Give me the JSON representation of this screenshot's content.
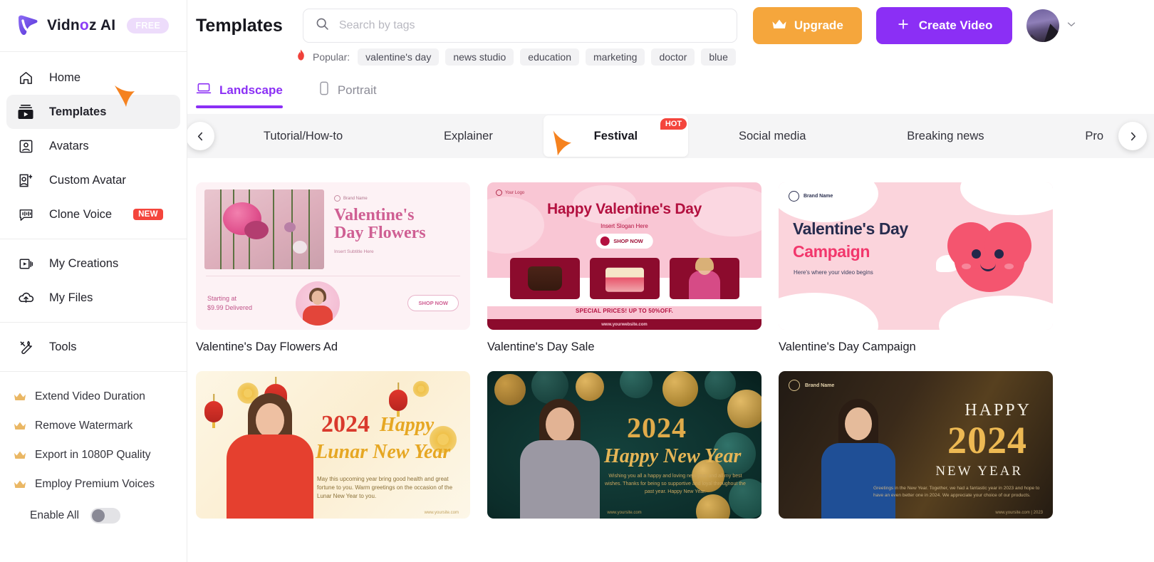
{
  "brand": {
    "name_pre": "Vidn",
    "name_o": "o",
    "name_post": "z AI",
    "plan_badge": "FREE"
  },
  "sidebar": {
    "nav_primary": [
      {
        "label": "Home",
        "icon": "home-icon",
        "active": false
      },
      {
        "label": "Templates",
        "icon": "templates-icon",
        "active": true
      },
      {
        "label": "Avatars",
        "icon": "avatar-icon",
        "active": false
      },
      {
        "label": "Custom Avatar",
        "icon": "custom-avatar-icon",
        "active": false
      },
      {
        "label": "Clone Voice",
        "icon": "voice-icon",
        "active": false,
        "badge": "NEW"
      }
    ],
    "nav_secondary": [
      {
        "label": "My Creations",
        "icon": "creations-icon"
      },
      {
        "label": "My Files",
        "icon": "files-icon"
      }
    ],
    "nav_tools": [
      {
        "label": "Tools",
        "icon": "tools-icon"
      }
    ],
    "perks": [
      {
        "label": "Extend Video Duration",
        "icon": "crown-icon"
      },
      {
        "label": "Remove Watermark",
        "icon": "crown-icon"
      },
      {
        "label": "Export in 1080P Quality",
        "icon": "crown-icon"
      },
      {
        "label": "Employ Premium Voices",
        "icon": "crown-icon"
      }
    ],
    "enable_all_label": "Enable All",
    "enable_all_on": false
  },
  "header": {
    "title": "Templates",
    "search_placeholder": "Search by tags",
    "search_value": "",
    "upgrade_label": "Upgrade",
    "create_label": "Create Video",
    "popular_label": "Popular:",
    "popular_tags": [
      "valentine's day",
      "news studio",
      "education",
      "marketing",
      "doctor",
      "blue"
    ]
  },
  "view_tabs": [
    {
      "label": "Landscape",
      "icon": "laptop-icon",
      "active": true
    },
    {
      "label": "Portrait",
      "icon": "phone-icon",
      "active": false
    }
  ],
  "categories": [
    {
      "label": "Tutorial/How-to",
      "active": false
    },
    {
      "label": "Explainer",
      "active": false
    },
    {
      "label": "Festival",
      "active": true,
      "badge": "HOT"
    },
    {
      "label": "Social media",
      "active": false
    },
    {
      "label": "Breaking news",
      "active": false
    },
    {
      "label": "Pro",
      "active": false,
      "truncated": true
    }
  ],
  "templates": [
    {
      "title": "Valentine's Day Flowers Ad",
      "thumb": {
        "brand": "Brand Name",
        "heading_line1": "Valentine's",
        "heading_line2": "Day Flowers",
        "subtitle": "Insert Subtitle Here",
        "price_line1": "Starting at",
        "price_line2": "$9.99 Delivered",
        "cta": "SHOP NOW"
      }
    },
    {
      "title": "Valentine's Day Sale",
      "thumb": {
        "logo": "Your Logo",
        "heading": "Happy Valentine's Day",
        "slogan": "Insert Slogan Here",
        "cta": "SHOP NOW",
        "special": "SPECIAL PRICES!  UP TO 50%OFF.",
        "website": "www.yourwebsite.com"
      }
    },
    {
      "title": "Valentine's Day Campaign",
      "thumb": {
        "brand": "Brand Name",
        "heading_line1": "Valentine's Day",
        "heading_line2": "Campaign",
        "subtitle": "Here's where your video begins"
      }
    },
    {
      "title": "",
      "thumb": {
        "year": "2024",
        "happy": "Happy",
        "heading": "Lunar New Year",
        "description": "May this upcoming year bring good health and great fortune to you. Warm greetings on the occasion of the Lunar New Year to you.",
        "website": "www.yoursite.com"
      }
    },
    {
      "title": "",
      "thumb": {
        "year": "2024",
        "heading": "Happy New Year",
        "description": "Wishing you all a happy and loving new year and all my best wishes. Thanks for being so supportive and loyal throughout the past year. Happy New Year.",
        "website": "www.yoursite.com"
      }
    },
    {
      "title": "",
      "thumb": {
        "brand": "Brand Name",
        "happy": "HAPPY",
        "year": "2024",
        "new_year": "NEW YEAR",
        "description": "Greetings in the New Year. Together, we had a fantastic year in 2023 and hope to have an even better one in 2024. We appreciate your choice of our products.",
        "website": "www.yoursite.com | 2023"
      }
    }
  ],
  "colors": {
    "accent_purple": "#8b2ff5",
    "upgrade_orange": "#f5a63c",
    "badge_red": "#f4453c",
    "cursor_orange": "#f5821f"
  }
}
